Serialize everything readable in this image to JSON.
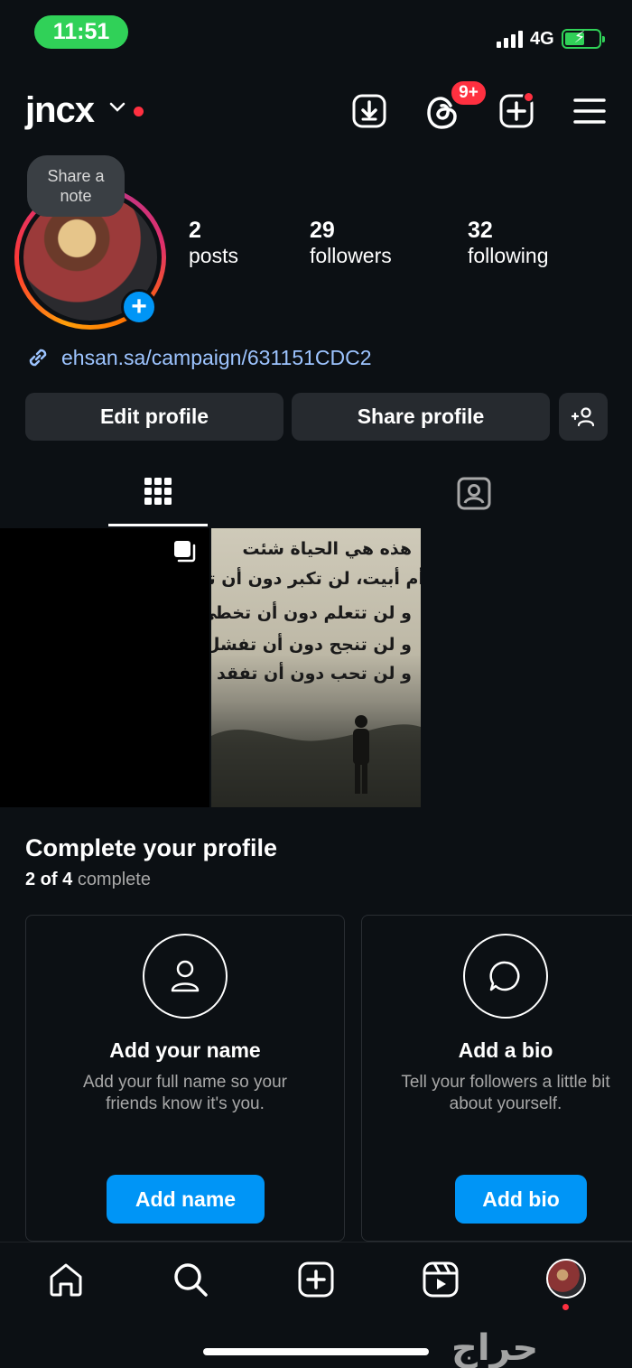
{
  "status_bar": {
    "time": "11:51",
    "network": "4G"
  },
  "header": {
    "username": "jncx",
    "notification_badge": "9+"
  },
  "profile": {
    "note_line1": "Share a",
    "note_line2": "note",
    "stats": [
      {
        "value": "2",
        "label": "posts"
      },
      {
        "value": "29",
        "label": "followers"
      },
      {
        "value": "32",
        "label": "following"
      }
    ],
    "link": "ehsan.sa/campaign/631151CDC2"
  },
  "actions": {
    "edit": "Edit profile",
    "share": "Share profile"
  },
  "post2_lines": [
    "هذه هي الحياة شئت",
    "أم أبيت، لن تكبر دون أن تتألم",
    "و لن تتعلم دون أن تخطئ",
    "و لن تنجح دون أن تفشل",
    "و لن تحب دون أن تفقد"
  ],
  "complete": {
    "title": "Complete your profile",
    "progress_bold": "2 of 4",
    "progress_rest": "complete",
    "cards": [
      {
        "title": "Add your name",
        "desc": "Add your full name so your\nfriends know it's you.",
        "button": "Add name"
      },
      {
        "title": "Add a bio",
        "desc": "Tell your followers a little bit\nabout yourself.",
        "button": "Add bio"
      }
    ]
  },
  "watermark": "حراج",
  "colors": {
    "accent": "#0095f6",
    "alert": "#ff3040",
    "battery": "#30d158"
  }
}
